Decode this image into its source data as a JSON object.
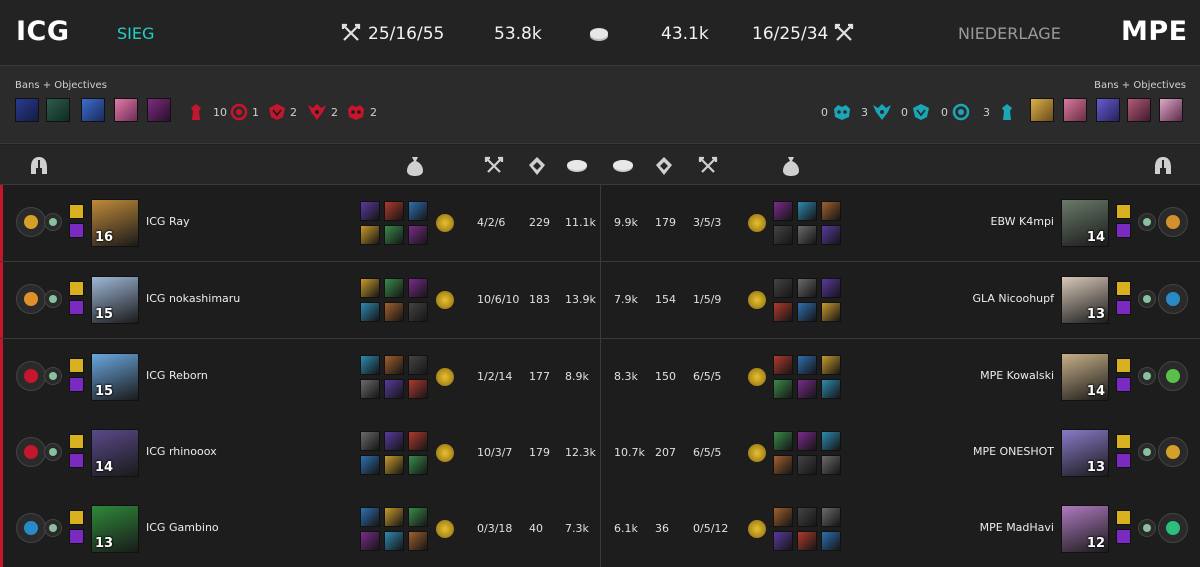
{
  "header": {
    "left_team": "ICG",
    "left_result": "SIEG",
    "left_kda": "25/16/55",
    "left_gold": "53.8k",
    "right_gold": "43.1k",
    "right_kda": "16/25/34",
    "right_result": "NIEDERLAGE",
    "right_team": "MPE"
  },
  "colors": {
    "red": "#c5162d",
    "teal": "#1aa6b7",
    "green_result": "#22d1c4"
  },
  "bans": {
    "label_left": "Bans + Objectives",
    "label_right": "Bans + Objectives",
    "left_objectives": [
      {
        "icon": "tower-icon",
        "count": "10"
      },
      {
        "icon": "inhibitor-icon",
        "count": "1"
      },
      {
        "icon": "herald-icon",
        "count": "2"
      },
      {
        "icon": "dragon-icon",
        "count": "2"
      },
      {
        "icon": "baron-icon",
        "count": "2"
      }
    ],
    "right_objectives": [
      {
        "icon": "baron-icon",
        "count": "0"
      },
      {
        "icon": "dragon-icon",
        "count": "3"
      },
      {
        "icon": "herald-icon",
        "count": "0"
      },
      {
        "icon": "inhibitor-icon",
        "count": "0"
      },
      {
        "icon": "tower-icon",
        "count": "3"
      }
    ]
  },
  "columns": {
    "left": [
      "helmet-icon",
      "gold-bag-icon",
      "kda-swords-icon",
      "cs-minion-icon",
      "gold-coin-icon"
    ],
    "right": [
      "gold-coin-icon",
      "cs-minion-icon",
      "kda-swords-icon",
      "gold-bag-icon",
      "helmet-icon"
    ]
  },
  "players": [
    {
      "l_name": "ICG Ray",
      "l_level": "16",
      "l_kda": "4/2/6",
      "l_cs": "229",
      "l_gold": "11.1k",
      "r_gold": "9.9k",
      "r_cs": "179",
      "r_kda": "3/5/3",
      "r_level": "14",
      "r_name": "EBW K4mpi"
    },
    {
      "l_name": "ICG nokashimaru",
      "l_level": "15",
      "l_kda": "10/6/10",
      "l_cs": "183",
      "l_gold": "13.9k",
      "r_gold": "7.9k",
      "r_cs": "154",
      "r_kda": "1/5/9",
      "r_level": "13",
      "r_name": "GLA Nicoohupf"
    },
    {
      "l_name": "ICG Reborn",
      "l_level": "15",
      "l_kda": "1/2/14",
      "l_cs": "177",
      "l_gold": "8.9k",
      "r_gold": "8.3k",
      "r_cs": "150",
      "r_kda": "6/5/5",
      "r_level": "14",
      "r_name": "MPE Kowalski"
    },
    {
      "l_name": "ICG rhinooox",
      "l_level": "14",
      "l_kda": "10/3/7",
      "l_cs": "179",
      "l_gold": "12.3k",
      "r_gold": "10.7k",
      "r_cs": "207",
      "r_kda": "6/5/5",
      "r_level": "13",
      "r_name": "MPE ONESHOT"
    },
    {
      "l_name": "ICG Gambino",
      "l_level": "13",
      "l_kda": "0/3/18",
      "l_cs": "40",
      "l_gold": "7.3k",
      "r_gold": "6.1k",
      "r_cs": "36",
      "r_kda": "0/5/12",
      "r_level": "12",
      "r_name": "MPE MadHavi"
    }
  ]
}
